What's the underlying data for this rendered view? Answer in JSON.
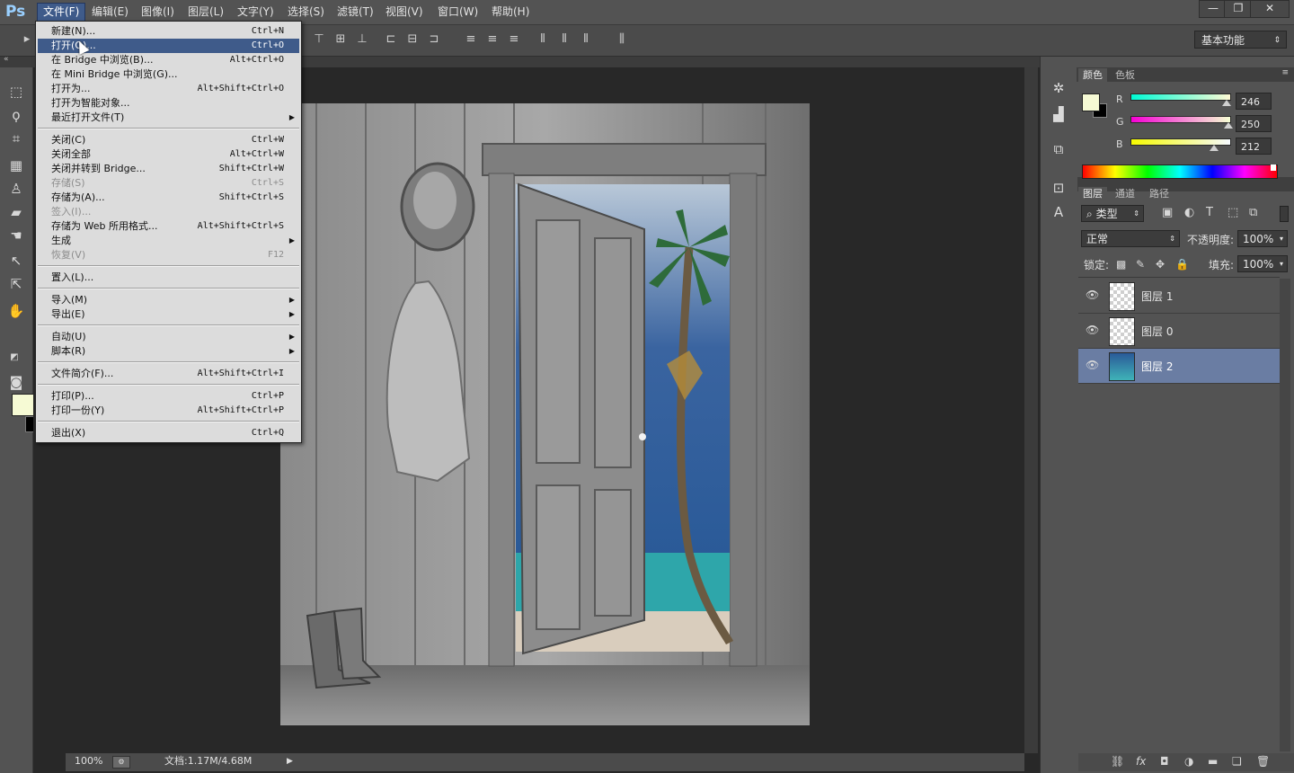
{
  "app": {
    "logo": "Ps"
  },
  "menubar": {
    "items": [
      "文件(F)",
      "编辑(E)",
      "图像(I)",
      "图层(L)",
      "文字(Y)",
      "选择(S)",
      "滤镜(T)",
      "视图(V)",
      "窗口(W)",
      "帮助(H)"
    ],
    "active_index": 0,
    "window_buttons": [
      "—",
      "❐",
      "✕"
    ]
  },
  "options_bar": {
    "workspace": "基本功能"
  },
  "file_menu": {
    "items": [
      {
        "label": "新建(N)...",
        "shortcut": "Ctrl+N"
      },
      {
        "label": "打开(O)...",
        "shortcut": "Ctrl+O",
        "highlighted": true
      },
      {
        "label": "在 Bridge 中浏览(B)...",
        "shortcut": "Alt+Ctrl+O"
      },
      {
        "label": "在 Mini Bridge 中浏览(G)...",
        "shortcut": ""
      },
      {
        "label": "打开为...",
        "shortcut": "Alt+Shift+Ctrl+O"
      },
      {
        "label": "打开为智能对象...",
        "shortcut": ""
      },
      {
        "label": "最近打开文件(T)",
        "shortcut": "",
        "submenu": true
      },
      {
        "label": "关闭(C)",
        "shortcut": "Ctrl+W"
      },
      {
        "label": "关闭全部",
        "shortcut": "Alt+Ctrl+W"
      },
      {
        "label": "关闭并转到 Bridge...",
        "shortcut": "Shift+Ctrl+W"
      },
      {
        "label": "存储(S)",
        "shortcut": "Ctrl+S",
        "disabled": true
      },
      {
        "label": "存储为(A)...",
        "shortcut": "Shift+Ctrl+S"
      },
      {
        "label": "签入(I)...",
        "shortcut": "",
        "disabled": true
      },
      {
        "label": "存储为 Web 所用格式...",
        "shortcut": "Alt+Shift+Ctrl+S"
      },
      {
        "label": "生成",
        "shortcut": "",
        "submenu": true
      },
      {
        "label": "恢复(V)",
        "shortcut": "F12",
        "disabled": true
      },
      {
        "label": "置入(L)...",
        "shortcut": ""
      },
      {
        "label": "导入(M)",
        "shortcut": "",
        "submenu": true
      },
      {
        "label": "导出(E)",
        "shortcut": "",
        "submenu": true
      },
      {
        "label": "自动(U)",
        "shortcut": "",
        "submenu": true
      },
      {
        "label": "脚本(R)",
        "shortcut": "",
        "submenu": true
      },
      {
        "label": "文件简介(F)...",
        "shortcut": "Alt+Shift+Ctrl+I"
      },
      {
        "label": "打印(P)...",
        "shortcut": "Ctrl+P"
      },
      {
        "label": "打印一份(Y)",
        "shortcut": "Alt+Shift+Ctrl+P"
      },
      {
        "label": "退出(X)",
        "shortcut": "Ctrl+Q"
      }
    ]
  },
  "color_panel": {
    "tabs": [
      "颜色",
      "色板"
    ],
    "r_label": "R",
    "g_label": "G",
    "b_label": "B",
    "r": "246",
    "g": "250",
    "b": "212",
    "foreground": "#f6fad4",
    "background": "#000000"
  },
  "layers_panel": {
    "tabs": [
      "图层",
      "通道",
      "路径"
    ],
    "filter_kind": "类型",
    "blend_mode": "正常",
    "opacity_label": "不透明度:",
    "opacity": "100%",
    "lock_label": "锁定:",
    "fill_label": "填充:",
    "fill": "100%",
    "layers": [
      {
        "name": "图层 1",
        "selected": false
      },
      {
        "name": "图层 0",
        "selected": false
      },
      {
        "name": "图层 2",
        "selected": true
      }
    ]
  },
  "status": {
    "zoom": "100%",
    "doc": "文档:1.17M/4.68M"
  }
}
